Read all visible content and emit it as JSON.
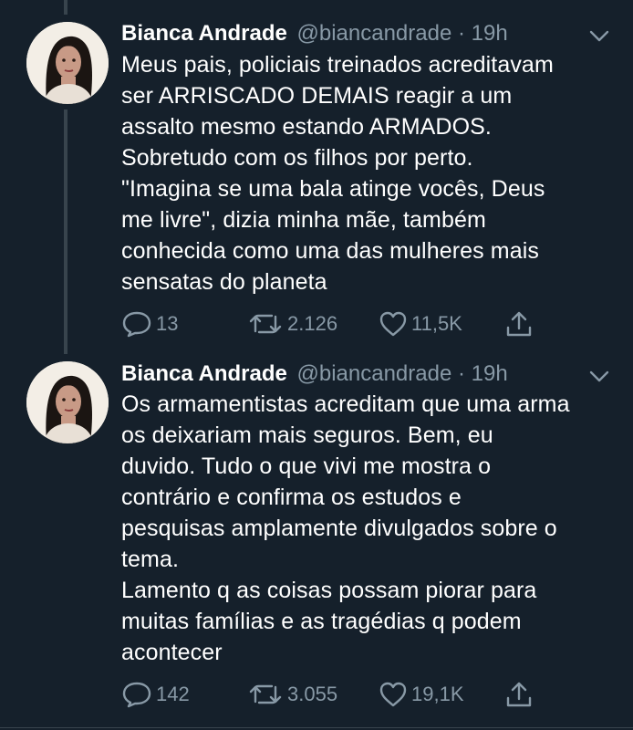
{
  "theme": {
    "background": "#15202b",
    "text": "#ffffff",
    "muted": "#8899a6",
    "thread_line": "#38444d"
  },
  "tweets": [
    {
      "author_name": "Bianca Andrade",
      "handle": "@biancandrade",
      "separator": "·",
      "time": "19h",
      "text": "Meus pais, policiais treinados acreditavam\nser ARRISCADO DEMAIS reagir a um\nassalto mesmo estando ARMADOS.\nSobretudo com os filhos por perto.\n\"Imagina se uma bala atinge vocês, Deus\nme livre\", dizia minha mãe, também\nconhecida como uma das mulheres mais\nsensatas do planeta",
      "replies": "13",
      "retweets": "2.126",
      "likes": "11,5K",
      "icons": [
        "reply-icon",
        "retweet-icon",
        "like-icon",
        "share-icon"
      ]
    },
    {
      "author_name": "Bianca Andrade",
      "handle": "@biancandrade",
      "separator": "·",
      "time": "19h",
      "text": "Os armamentistas acreditam que uma arma\nos deixariam mais seguros. Bem, eu\nduvido. Tudo o que vivi me mostra o\ncontrário e confirma os estudos e\npesquisas amplamente divulgados sobre o\ntema.\nLamento q as coisas possam piorar para\nmuitas famílias e as tragédias q podem\nacontecer",
      "replies": "142",
      "retweets": "3.055",
      "likes": "19,1K",
      "icons": [
        "reply-icon",
        "retweet-icon",
        "like-icon",
        "share-icon"
      ]
    }
  ]
}
